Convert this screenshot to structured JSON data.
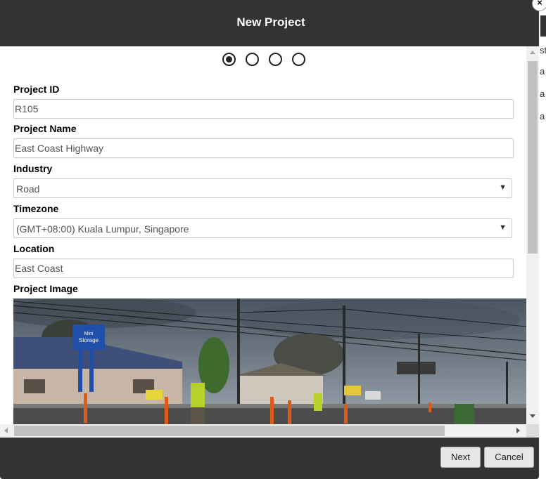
{
  "modal": {
    "title": "New Project",
    "close_glyph": "×"
  },
  "steps": {
    "count": 4,
    "active_index": 0
  },
  "form": {
    "project_id": {
      "label": "Project ID",
      "value": "R105"
    },
    "project_name": {
      "label": "Project Name",
      "value": "East Coast Highway"
    },
    "industry": {
      "label": "Industry",
      "value": "Road"
    },
    "timezone": {
      "label": "Timezone",
      "value": "(GMT+08:00) Kuala Lumpur, Singapore"
    },
    "location": {
      "label": "Location",
      "value": "East Coast"
    },
    "project_image": {
      "label": "Project Image",
      "sign_line1": "Mini",
      "sign_line2": "Storage"
    }
  },
  "footer": {
    "next_label": "Next",
    "cancel_label": "Cancel"
  },
  "background_page": {
    "fragments": [
      "st",
      "a",
      "a",
      "a"
    ]
  },
  "icons": {
    "dropdown": "chevron-down-icon",
    "close": "close-icon"
  },
  "colors": {
    "header_bg": "#333333",
    "footer_bg": "#333333",
    "input_border": "#cccccc"
  }
}
